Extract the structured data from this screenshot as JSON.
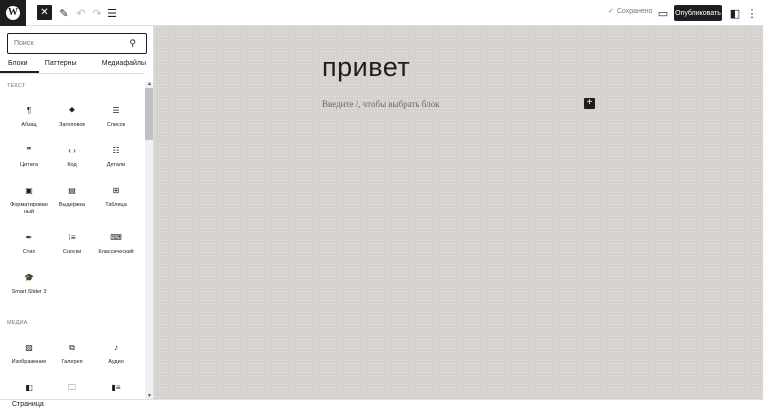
{
  "topbar": {
    "logo_letter": "W",
    "saved_label": "Сохранено",
    "publish_label": "Опубликовать"
  },
  "sidebar": {
    "search_placeholder": "Поиск",
    "tabs": [
      "Блоки",
      "Паттерны",
      "Медиафайлы"
    ],
    "sections": {
      "text": "ТЕКСТ",
      "media": "МЕДИА"
    },
    "text_blocks": [
      {
        "icon": "paragraph-icon",
        "label": "Абзац"
      },
      {
        "icon": "heading-icon",
        "label": "Заголовок"
      },
      {
        "icon": "list-icon",
        "label": "Список"
      },
      {
        "icon": "quote-icon",
        "label": "Цитата"
      },
      {
        "icon": "code-icon",
        "label": "Код"
      },
      {
        "icon": "details-icon",
        "label": "Детали"
      },
      {
        "icon": "preformatted-icon",
        "label": "Форматированный"
      },
      {
        "icon": "pullquote-icon",
        "label": "Выдержка"
      },
      {
        "icon": "table-icon",
        "label": "Таблица"
      },
      {
        "icon": "verse-icon",
        "label": "Стих"
      },
      {
        "icon": "footnotes-icon",
        "label": "Сноски"
      },
      {
        "icon": "classic-icon",
        "label": "Классический"
      },
      {
        "icon": "smart-slider-icon",
        "label": "Smart Slider 3"
      }
    ],
    "media_blocks": [
      {
        "icon": "image-icon",
        "label": "Изображение"
      },
      {
        "icon": "gallery-icon",
        "label": "Галерея"
      },
      {
        "icon": "audio-icon",
        "label": "Аудио"
      },
      {
        "icon": "cover-icon",
        "label": ""
      },
      {
        "icon": "file-icon",
        "label": ""
      },
      {
        "icon": "media-text-icon",
        "label": ""
      }
    ]
  },
  "canvas": {
    "title": "привет",
    "placeholder": "Введите /, чтобы выбрать блок"
  },
  "footer": {
    "breadcrumb": "Страница"
  }
}
